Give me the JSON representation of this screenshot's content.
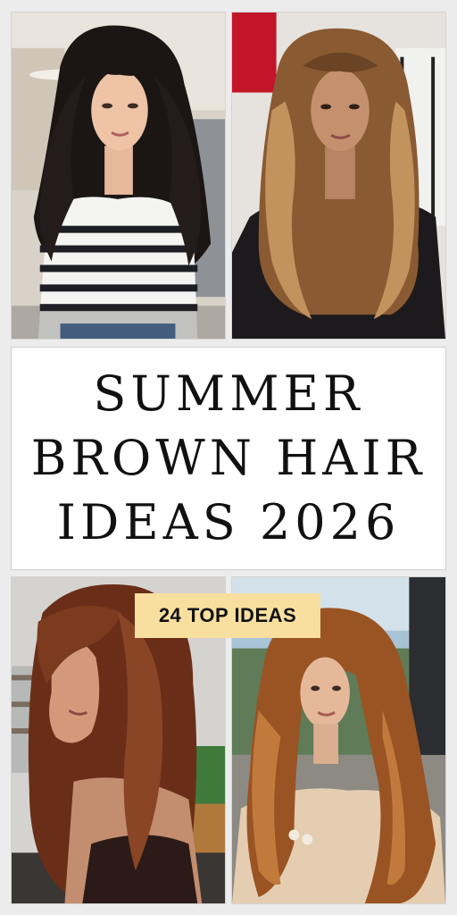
{
  "title": {
    "lines": [
      "SUMMER",
      "BROWN HAIR",
      "IDEAS 2026"
    ]
  },
  "badge": {
    "label": "24 TOP IDEAS",
    "color": "#f8dfa0"
  },
  "photos": [
    {
      "name": "dark-layered-waves-photo",
      "hair_color": "#1b1514"
    },
    {
      "name": "balayage-waves-photo",
      "hair_color": "#8a5a32"
    },
    {
      "name": "chestnut-layers-photo",
      "hair_color": "#6a2e18"
    },
    {
      "name": "copper-brown-waves-photo",
      "hair_color": "#9a5424"
    }
  ],
  "colors": {
    "background": "#ececec",
    "card": "#ffffff",
    "text": "#111111"
  }
}
